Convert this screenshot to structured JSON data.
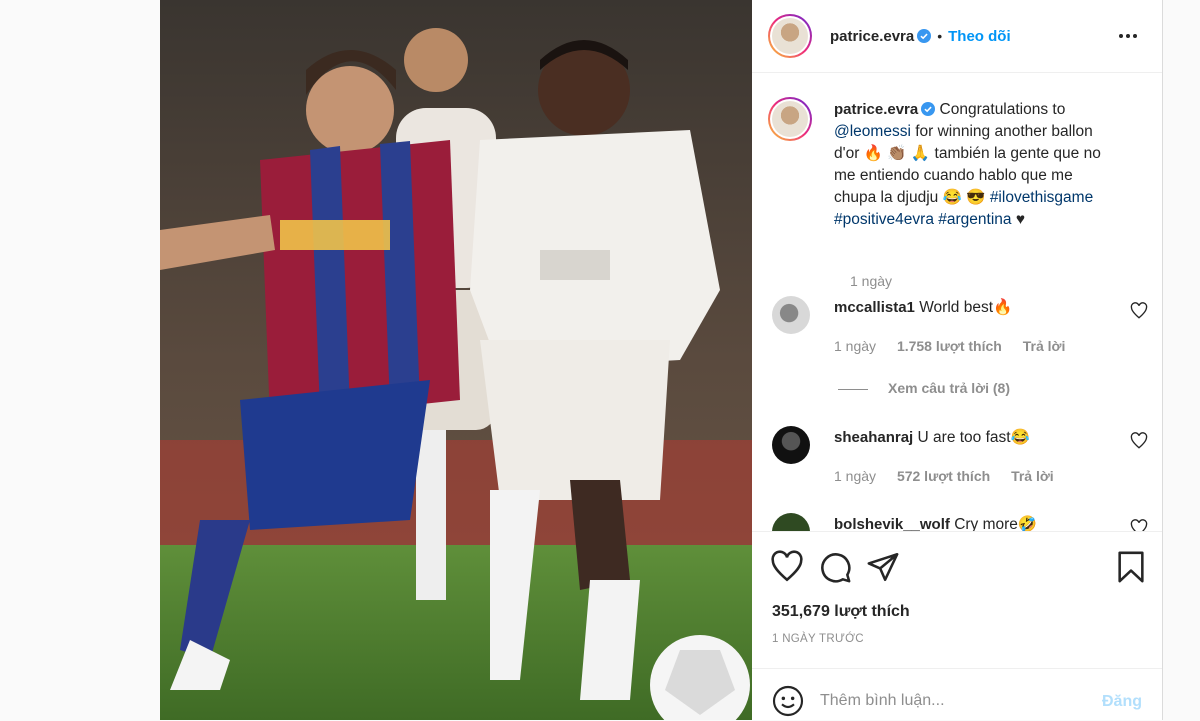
{
  "post": {
    "username": "patrice.evra",
    "follow_separator": "•",
    "follow_label": "Theo dõi",
    "caption": {
      "line1_text": "Congratulations to",
      "mention": "@leomessi",
      "line2_text": "for winning another ballon",
      "line3_text": "d'or",
      "line3_emojis": "🔥 👏🏽 🙏",
      "line3_rest": "también la gente que no",
      "line4_text": "me entiendo cuando hablo que me",
      "line5_text": "chupa la djudju",
      "line5_emojis": "😂 😎",
      "hashtag1": "#ilovethisgame",
      "hashtag2": "#positive4evra",
      "hashtag3": "#argentina",
      "trailing": "♥",
      "time": "1 ngày"
    },
    "comments": [
      {
        "user": "mccallista1",
        "text": "World best🔥",
        "time": "1 ngày",
        "likes": "1.758 lượt thích",
        "reply": "Trả lời"
      },
      {
        "user": "sheahanraj",
        "text": "U are too fast😂",
        "time": "1 ngày",
        "likes": "572 lượt thích",
        "reply": "Trả lời"
      },
      {
        "user": "bolshevik__wolf",
        "text": "Cry more🤣"
      }
    ],
    "view_replies": "Xem câu trả lời (8)",
    "likes_count": "351,679 lượt thích",
    "time_ago": "1 NGÀY TRƯỚC",
    "comment_placeholder": "Thêm bình luận...",
    "post_button": "Đăng",
    "colors": {
      "link": "#00376b",
      "follow": "#0095f6",
      "verified": "#3897f0",
      "post_disabled": "#b2dffc"
    }
  }
}
